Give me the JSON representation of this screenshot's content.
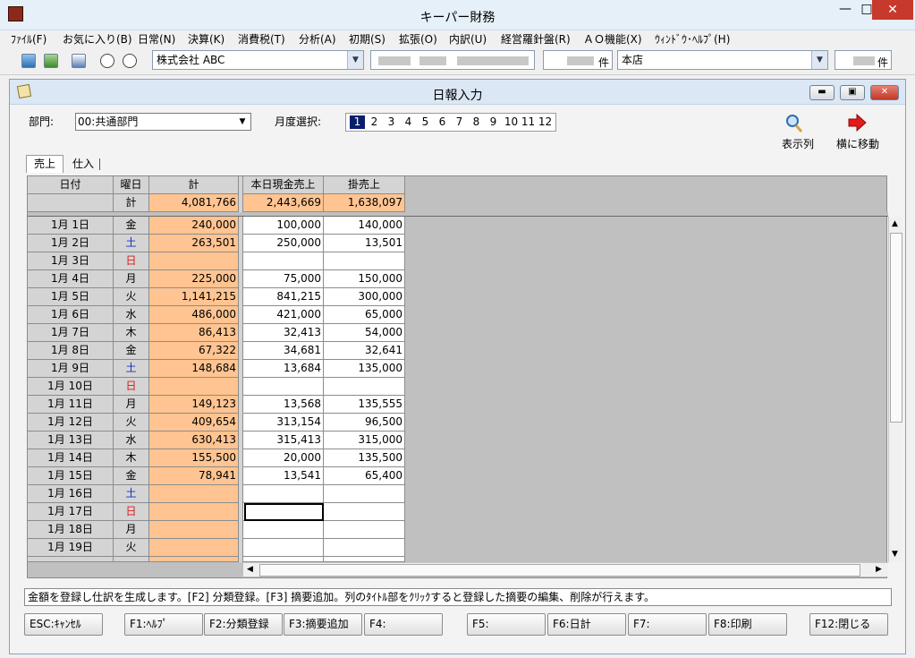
{
  "app": {
    "title": "キーパー財務"
  },
  "menu": [
    {
      "label": "ﾌｧｲﾙ(F)"
    },
    {
      "label": "お気に入り(B)"
    },
    {
      "label": "日常(N)"
    },
    {
      "label": "決算(K)"
    },
    {
      "label": "消費税(T)"
    },
    {
      "label": "分析(A)"
    },
    {
      "label": "初期(S)"
    },
    {
      "label": "拡張(O)"
    },
    {
      "label": "内訳(U)"
    },
    {
      "label": "経営羅針盤(R)"
    },
    {
      "label": "ＡＯ機能(X)"
    },
    {
      "label": "ｳｨﾝﾄﾞｳ･ﾍﾙﾌﾟ(H)"
    }
  ],
  "toolbar": {
    "company": "株式会社 ABC",
    "count_suffix": "件",
    "branch": "本店",
    "count2_suffix": "件"
  },
  "window": {
    "title": "日報入力"
  },
  "form": {
    "dept_label": "部門:",
    "dept_value": "00:共通部門",
    "month_label": "月度選択:",
    "months": [
      "1",
      "2",
      "3",
      "4",
      "5",
      "6",
      "7",
      "8",
      "9",
      "10",
      "11",
      "12"
    ],
    "selected_month": "1",
    "show_columns_label": "表示列",
    "move_right_label": "横に移動"
  },
  "tabs": [
    {
      "label": "売上"
    },
    {
      "label": "仕入"
    }
  ],
  "grid": {
    "headers": [
      "日付",
      "曜日",
      "計",
      "本日現金売上",
      "掛売上"
    ],
    "totals": {
      "label": "計",
      "total": "4,081,766",
      "cash": "2,443,669",
      "credit": "1,638,097"
    },
    "rows": [
      {
        "date": "1月  1日",
        "dow": "金",
        "total": "240,000",
        "cash": "100,000",
        "credit": "140,000"
      },
      {
        "date": "1月  2日",
        "dow": "土",
        "total": "263,501",
        "cash": "250,000",
        "credit": "13,501"
      },
      {
        "date": "1月  3日",
        "dow": "日",
        "total": "",
        "cash": "",
        "credit": ""
      },
      {
        "date": "1月  4日",
        "dow": "月",
        "total": "225,000",
        "cash": "75,000",
        "credit": "150,000"
      },
      {
        "date": "1月  5日",
        "dow": "火",
        "total": "1,141,215",
        "cash": "841,215",
        "credit": "300,000"
      },
      {
        "date": "1月  6日",
        "dow": "水",
        "total": "486,000",
        "cash": "421,000",
        "credit": "65,000"
      },
      {
        "date": "1月  7日",
        "dow": "木",
        "total": "86,413",
        "cash": "32,413",
        "credit": "54,000"
      },
      {
        "date": "1月  8日",
        "dow": "金",
        "total": "67,322",
        "cash": "34,681",
        "credit": "32,641"
      },
      {
        "date": "1月  9日",
        "dow": "土",
        "total": "148,684",
        "cash": "13,684",
        "credit": "135,000"
      },
      {
        "date": "1月 10日",
        "dow": "日",
        "total": "",
        "cash": "",
        "credit": ""
      },
      {
        "date": "1月 11日",
        "dow": "月",
        "total": "149,123",
        "cash": "13,568",
        "credit": "135,555"
      },
      {
        "date": "1月 12日",
        "dow": "火",
        "total": "409,654",
        "cash": "313,154",
        "credit": "96,500"
      },
      {
        "date": "1月 13日",
        "dow": "水",
        "total": "630,413",
        "cash": "315,413",
        "credit": "315,000"
      },
      {
        "date": "1月 14日",
        "dow": "木",
        "total": "155,500",
        "cash": "20,000",
        "credit": "135,500"
      },
      {
        "date": "1月 15日",
        "dow": "金",
        "total": "78,941",
        "cash": "13,541",
        "credit": "65,400"
      },
      {
        "date": "1月 16日",
        "dow": "土",
        "total": "",
        "cash": "",
        "credit": ""
      },
      {
        "date": "1月 17日",
        "dow": "日",
        "total": "",
        "cash": "",
        "credit": ""
      },
      {
        "date": "1月 18日",
        "dow": "月",
        "total": "",
        "cash": "",
        "credit": ""
      },
      {
        "date": "1月 19日",
        "dow": "火",
        "total": "",
        "cash": "",
        "credit": ""
      }
    ]
  },
  "status": {
    "text": "金額を登録し仕訳を生成します。[F2] 分類登録。[F3] 摘要追加。列のﾀｲﾄﾙ部をｸﾘｯｸすると登録した摘要の編集、削除が行えます。"
  },
  "fkeys": [
    {
      "label": "ESC:ｷｬﾝｾﾙ"
    },
    {
      "label": "F1:ﾍﾙﾌﾟ"
    },
    {
      "label": "F2:分類登録"
    },
    {
      "label": "F3:摘要追加"
    },
    {
      "label": "F4:"
    },
    {
      "label": "F5:"
    },
    {
      "label": "F6:日計"
    },
    {
      "label": "F7:"
    },
    {
      "label": "F8:印刷"
    },
    {
      "label": "F12:閉じる"
    }
  ],
  "colors": {
    "highlight": "#ffc491",
    "saturday": "#1530c0",
    "sunday": "#d61c1c",
    "selected_month": "#0a1f6b"
  }
}
